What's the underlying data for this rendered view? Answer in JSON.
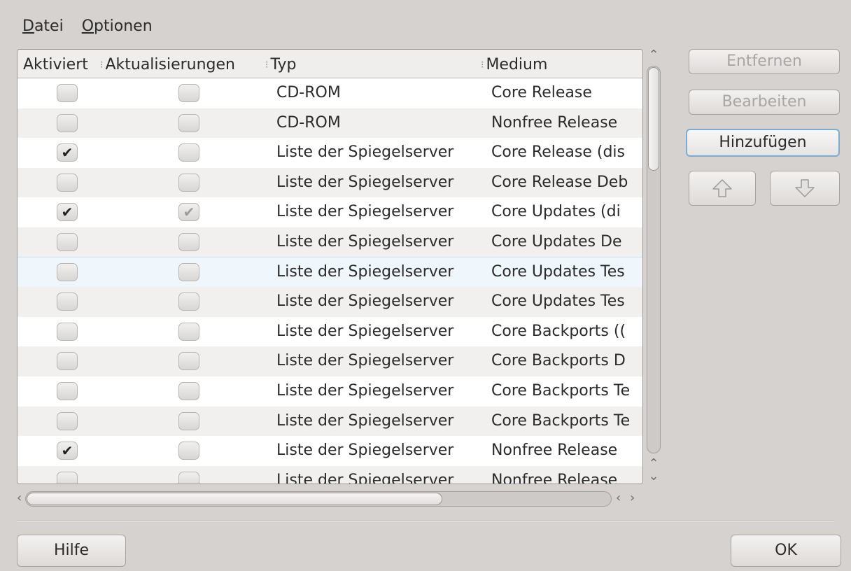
{
  "menubar": {
    "items": [
      {
        "mnemonic": "D",
        "rest": "atei"
      },
      {
        "mnemonic": "O",
        "rest": "ptionen"
      }
    ]
  },
  "table": {
    "columns": [
      "Aktiviert",
      "Aktualisierungen",
      "Typ",
      "Medium"
    ],
    "rows": [
      {
        "enabled": false,
        "updates": false,
        "type": "CD-ROM",
        "medium": "Core Release"
      },
      {
        "enabled": false,
        "updates": false,
        "type": "CD-ROM",
        "medium": "Nonfree Release"
      },
      {
        "enabled": true,
        "updates": false,
        "type": "Liste der Spiegelserver",
        "medium": "Core Release (dis"
      },
      {
        "enabled": false,
        "updates": false,
        "type": "Liste der Spiegelserver",
        "medium": "Core Release Deb"
      },
      {
        "enabled": true,
        "updates": true,
        "type": "Liste der Spiegelserver",
        "medium": "Core Updates (di"
      },
      {
        "enabled": false,
        "updates": false,
        "type": "Liste der Spiegelserver",
        "medium": "Core Updates De"
      },
      {
        "enabled": false,
        "updates": false,
        "type": "Liste der Spiegelserver",
        "medium": "Core Updates Tes"
      },
      {
        "enabled": false,
        "updates": false,
        "type": "Liste der Spiegelserver",
        "medium": "Core Updates Tes"
      },
      {
        "enabled": false,
        "updates": false,
        "type": "Liste der Spiegelserver",
        "medium": "Core Backports (("
      },
      {
        "enabled": false,
        "updates": false,
        "type": "Liste der Spiegelserver",
        "medium": "Core Backports D"
      },
      {
        "enabled": false,
        "updates": false,
        "type": "Liste der Spiegelserver",
        "medium": "Core Backports Te"
      },
      {
        "enabled": false,
        "updates": false,
        "type": "Liste der Spiegelserver",
        "medium": "Core Backports Te"
      },
      {
        "enabled": true,
        "updates": false,
        "type": "Liste der Spiegelserver",
        "medium": "Nonfree Release"
      },
      {
        "enabled": false,
        "updates": false,
        "type": "Liste der Spiegelserver",
        "medium": "Nonfree Release"
      }
    ],
    "highlighted_row": 6
  },
  "buttons": {
    "remove": "Entfernen",
    "edit": "Bearbeiten",
    "add": "Hinzufügen",
    "up_icon": "arrow-up-icon",
    "down_icon": "arrow-down-icon",
    "help": "Hilfe",
    "ok": "OK"
  },
  "icons": {
    "check": "✔",
    "scroll_up": "⌃",
    "scroll_down": "⌄",
    "scroll_left": "‹",
    "scroll_right": "›"
  },
  "colors": {
    "focus_border": "#7faad2",
    "window_bg": "#d6d2d0",
    "row_highlight": "#eff6fc"
  }
}
